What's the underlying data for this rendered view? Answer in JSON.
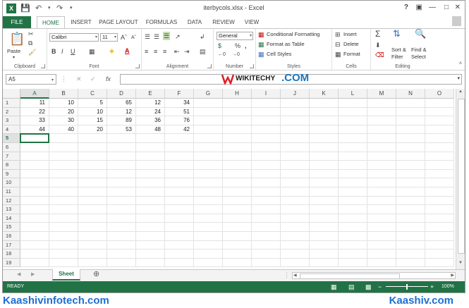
{
  "app": {
    "title": "iterbycols.xlsx - Excel",
    "user": "",
    "window_controls": [
      "?",
      "▣",
      "—",
      "□",
      "✕"
    ]
  },
  "tabs": [
    "FILE",
    "HOME",
    "INSERT",
    "PAGE LAYOUT",
    "FORMULAS",
    "DATA",
    "REVIEW",
    "VIEW"
  ],
  "ribbon": {
    "clipboard": {
      "label": "Clipboard",
      "paste": "Paste"
    },
    "font": {
      "label": "Font",
      "name": "Calibri",
      "size": "11",
      "bold": "B",
      "italic": "I",
      "underline": "U"
    },
    "alignment": {
      "label": "Alignment"
    },
    "number": {
      "label": "Number",
      "format": "General"
    },
    "styles": {
      "label": "Styles",
      "conditional": "Conditional Formatting",
      "format_table": "Format as Table",
      "cell_styles": "Cell Styles"
    },
    "cells": {
      "label": "Cells",
      "insert": "Insert",
      "delete": "Delete",
      "format": "Format"
    },
    "editing": {
      "label": "Editing",
      "sort": "Sort &",
      "filter": "Filter",
      "find": "Find &",
      "select": "Select"
    }
  },
  "formula_bar": {
    "name_box": "A5",
    "fx": "fx",
    "content": ""
  },
  "watermark": {
    "brand": "WIKITECHY",
    "suffix": ".COM"
  },
  "columns": [
    "A",
    "B",
    "C",
    "D",
    "E",
    "F",
    "G",
    "H",
    "I",
    "J",
    "K",
    "L",
    "M",
    "N",
    "O"
  ],
  "rows": [
    "1",
    "2",
    "3",
    "4",
    "5",
    "6",
    "7",
    "8",
    "9",
    "10",
    "11",
    "12",
    "13",
    "14",
    "15",
    "16",
    "17",
    "18",
    "19"
  ],
  "cells": [
    [
      "11",
      "10",
      "5",
      "65",
      "12",
      "34"
    ],
    [
      "22",
      "20",
      "10",
      "12",
      "24",
      "51"
    ],
    [
      "33",
      "30",
      "15",
      "89",
      "36",
      "76"
    ],
    [
      "44",
      "40",
      "20",
      "53",
      "48",
      "42"
    ]
  ],
  "active_cell": {
    "col": "A",
    "row": "5"
  },
  "sheet_tabs": [
    "Sheet"
  ],
  "status": {
    "ready": "READY",
    "zoom": "100%"
  },
  "footer": {
    "left": "Kaashivinfotech.com",
    "right": "Kaashiv.com"
  },
  "colors": {
    "accent": "#217346",
    "footer_text": "#1e6fd1",
    "watermark_red": "#e31e24",
    "watermark_blue": "#1b75bc"
  }
}
